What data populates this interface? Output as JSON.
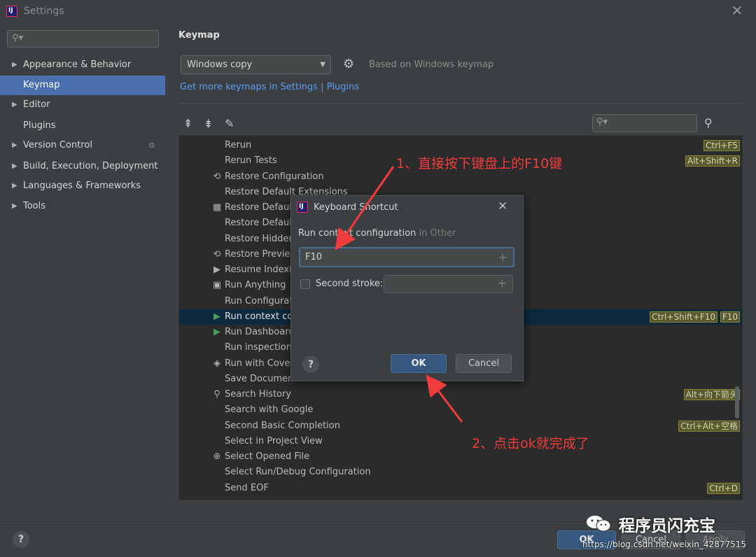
{
  "window": {
    "title": "Settings",
    "close_glyph": "✕"
  },
  "sidebar": {
    "items": [
      {
        "label": "Appearance & Behavior",
        "arrow": "▶"
      },
      {
        "label": "Keymap"
      },
      {
        "label": "Editor",
        "arrow": "▶"
      },
      {
        "label": "Plugins"
      },
      {
        "label": "Version Control",
        "arrow": "▶",
        "extra": "⧉"
      },
      {
        "label": "Build, Execution, Deployment",
        "arrow": "▶"
      },
      {
        "label": "Languages & Frameworks",
        "arrow": "▶"
      },
      {
        "label": "Tools",
        "arrow": "▶"
      }
    ],
    "selected": "Keymap"
  },
  "keymap": {
    "heading": "Keymap",
    "selected_keymap": "Windows copy",
    "based_on": "Based on Windows keymap",
    "get_more_link": "Get more keymaps in Settings | Plugins"
  },
  "actions": [
    {
      "name": "Rerun",
      "shortcuts": [
        "Ctrl+F5"
      ]
    },
    {
      "name": "Rerun Tests",
      "shortcuts": [
        "Alt+Shift+R"
      ]
    },
    {
      "name": "Restore Configuration",
      "icon": "⟲"
    },
    {
      "name": "Restore Default Extensions"
    },
    {
      "name": "Restore Defaul",
      "icon": "▦"
    },
    {
      "name": "Restore Defaul"
    },
    {
      "name": "Restore Hidden"
    },
    {
      "name": "Restore Previe",
      "icon": "⟲"
    },
    {
      "name": "Resume Indexin",
      "icon": "▶"
    },
    {
      "name": "Run Anything",
      "icon": "▣"
    },
    {
      "name": "Run Configurat"
    },
    {
      "name": "Run context co",
      "icon": "▶",
      "shortcuts": [
        "Ctrl+Shift+F10",
        "F10"
      ],
      "selected": true
    },
    {
      "name": "Run Dashboard",
      "icon": "▶"
    },
    {
      "name": "Run inspection"
    },
    {
      "name": "Run with Cover",
      "icon": "◈"
    },
    {
      "name": "Save Documen"
    },
    {
      "name": "Search History",
      "icon": "⚲",
      "shortcuts": [
        "Alt+向下箭头"
      ]
    },
    {
      "name": "Search with Google"
    },
    {
      "name": "Second Basic Completion",
      "shortcuts": [
        "Ctrl+Alt+空格"
      ]
    },
    {
      "name": "Select in Project View"
    },
    {
      "name": "Select Opened File",
      "icon": "⊕"
    },
    {
      "name": "Select Run/Debug Configuration"
    },
    {
      "name": "Send EOF",
      "shortcuts": [
        "Ctrl+D"
      ]
    }
  ],
  "dialog": {
    "title": "Keyboard Shortcut",
    "close_glyph": "✕",
    "action_label": "Run context configuration",
    "action_group": "in Other",
    "first_stroke": "F10",
    "second_stroke_label": "Second stroke:",
    "ok": "OK",
    "cancel": "Cancel",
    "help": "?"
  },
  "footer": {
    "help": "?",
    "ok": "OK",
    "cancel": "Cancel",
    "apply": "Apply"
  },
  "annotations": {
    "step1": "1、直接按下键盘上的F10键",
    "step2": "2、点击ok就完成了"
  },
  "watermark": {
    "text": "程序员闪充宝",
    "url": "https://blog.csdn.net/weixin_42877515"
  },
  "colors": {
    "annotation": "#f03c3c",
    "selection": "#4b6eaf",
    "link": "#589df6"
  },
  "icons": [
    "search-icon",
    "gear-icon",
    "expand-all-icon",
    "collapse-all-icon",
    "edit-icon",
    "find-shortcut-icon",
    "close-icon",
    "plus-icon",
    "help-icon"
  ]
}
